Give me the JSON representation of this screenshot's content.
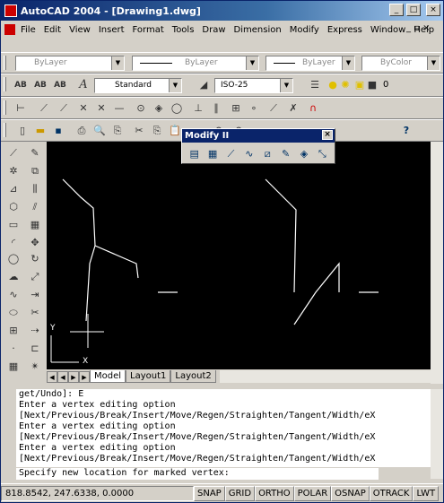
{
  "window": {
    "title": "AutoCAD 2004 - [Drawing1.dwg]"
  },
  "titlebar_buttons": {
    "minimize": "_",
    "maximize": "□",
    "close": "×"
  },
  "menu": [
    "File",
    "Edit",
    "View",
    "Insert",
    "Format",
    "Tools",
    "Draw",
    "Dimension",
    "Modify",
    "Express",
    "Window",
    "Help"
  ],
  "mdi_controls": "_ ▫ ×",
  "properties_toolbar": {
    "layer": "ByLayer",
    "linetype": "ByLayer",
    "lineweight": "ByLayer",
    "color": "ByColor"
  },
  "styles_toolbar": {
    "text_style": "Standard",
    "dim_style": "ISO-25",
    "layer_value": "0"
  },
  "palette": {
    "title": "Modify II",
    "close": "×",
    "icons": [
      "draworder-icon",
      "hatchedit-icon",
      "polyedit-icon",
      "splinedit-icon",
      "mledit-icon",
      "attedit-icon",
      "blockattedit-icon",
      "attext-icon"
    ]
  },
  "tabs": {
    "model": "Model",
    "layout1": "Layout1",
    "layout2": "Layout2"
  },
  "ucs": {
    "y": "Y",
    "x": "X"
  },
  "command_history": [
    "get/Undo]: E",
    "Enter a vertex editing option",
    "[Next/Previous/Break/Insert/Move/Regen/Straighten/Tangent/Width/eX",
    "Enter a vertex editing option",
    "[Next/Previous/Break/Insert/Move/Regen/Straighten/Tangent/Width/eX",
    "Enter a vertex editing option",
    "[Next/Previous/Break/Insert/Move/Regen/Straighten/Tangent/Width/eX"
  ],
  "command_prompt": "Specify new location for marked vertex:",
  "status": {
    "coords": "818.8542, 247.6338, 0.0000",
    "buttons": [
      "SNAP",
      "GRID",
      "ORTHO",
      "POLAR",
      "OSNAP",
      "OTRACK",
      "LWT"
    ]
  },
  "colors": {
    "canvas": "#000000",
    "entity": "#ffffff",
    "titlebar": "#0a246a"
  }
}
